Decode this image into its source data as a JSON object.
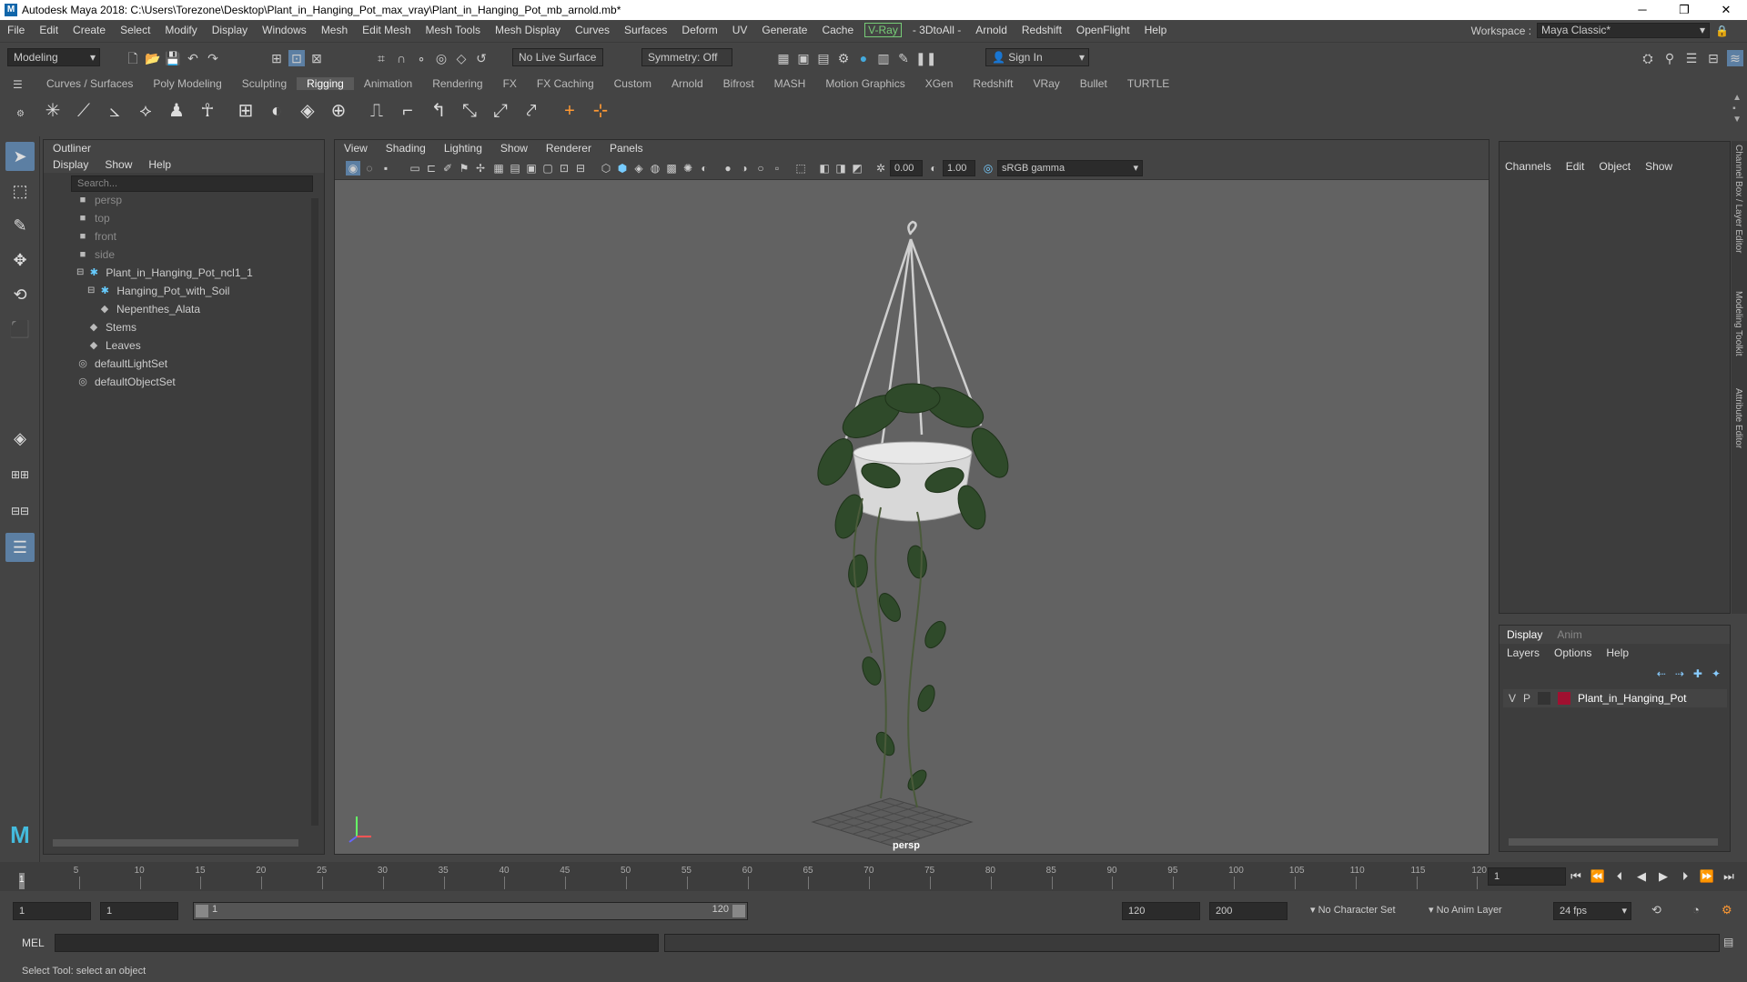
{
  "window": {
    "title": "Autodesk Maya 2018: C:\\Users\\Torezone\\Desktop\\Plant_in_Hanging_Pot_max_vray\\Plant_in_Hanging_Pot_mb_arnold.mb*",
    "logo": "M",
    "minimize": "─",
    "maximize": "❐",
    "close": "✕"
  },
  "menubar": {
    "items": [
      "File",
      "Edit",
      "Create",
      "Select",
      "Modify",
      "Display",
      "Windows",
      "Mesh",
      "Edit Mesh",
      "Mesh Tools",
      "Mesh Display",
      "Curves",
      "Surfaces",
      "Deform",
      "UV",
      "Generate",
      "Cache"
    ],
    "vray": "V-Ray",
    "items2": [
      "- 3DtoAll -",
      "Arnold",
      "Redshift",
      "OpenFlight",
      "Help"
    ]
  },
  "workspace": {
    "label": "Workspace :",
    "value": "Maya Classic*"
  },
  "statusline": {
    "mode": "Modeling",
    "live_surface": "No Live Surface",
    "symmetry": "Symmetry: Off",
    "sign_in": "Sign In"
  },
  "shelf": {
    "tabs": [
      "Curves / Surfaces",
      "Poly Modeling",
      "Sculpting",
      "Rigging",
      "Animation",
      "Rendering",
      "FX",
      "FX Caching",
      "Custom",
      "Arnold",
      "Bifrost",
      "MASH",
      "Motion Graphics",
      "XGen",
      "Redshift",
      "VRay",
      "Bullet",
      "TURTLE"
    ],
    "active_tab": "Rigging"
  },
  "outliner": {
    "title": "Outliner",
    "menu": [
      "Display",
      "Show",
      "Help"
    ],
    "search_placeholder": "Search...",
    "items": [
      {
        "label": "persp",
        "depth": 1,
        "icon": "camera-icon",
        "dim": true
      },
      {
        "label": "top",
        "depth": 1,
        "icon": "camera-icon",
        "dim": true
      },
      {
        "label": "front",
        "depth": 1,
        "icon": "camera-icon",
        "dim": true
      },
      {
        "label": "side",
        "depth": 1,
        "icon": "camera-icon",
        "dim": true
      },
      {
        "label": "Plant_in_Hanging_Pot_ncl1_1",
        "depth": 1,
        "icon": "joint-icon",
        "dim": false,
        "expander": "⊟"
      },
      {
        "label": "Hanging_Pot_with_Soil",
        "depth": 2,
        "icon": "joint-icon",
        "dim": false,
        "expander": "⊟"
      },
      {
        "label": "Nepenthes_Alata",
        "depth": 3,
        "icon": "mesh-icon",
        "dim": false
      },
      {
        "label": "Stems",
        "depth": 2,
        "icon": "mesh-icon",
        "dim": false
      },
      {
        "label": "Leaves",
        "depth": 2,
        "icon": "mesh-icon",
        "dim": false
      },
      {
        "label": "defaultLightSet",
        "depth": 1,
        "icon": "set-icon",
        "dim": false
      },
      {
        "label": "defaultObjectSet",
        "depth": 1,
        "icon": "set-icon",
        "dim": false
      }
    ]
  },
  "viewport": {
    "menu": [
      "View",
      "Shading",
      "Lighting",
      "Show",
      "Renderer",
      "Panels"
    ],
    "exposure": "0.00",
    "gamma": "1.00",
    "color_space": "sRGB gamma",
    "camera": "persp"
  },
  "channelbox": {
    "menu": [
      "Channels",
      "Edit",
      "Object",
      "Show"
    ]
  },
  "layers": {
    "tabs": [
      "Display",
      "Anim"
    ],
    "active_tab": "Display",
    "menu": [
      "Layers",
      "Options",
      "Help"
    ],
    "layer": {
      "v": "V",
      "p": "P",
      "name": "Plant_in_Hanging_Pot",
      "color": "#a01030"
    }
  },
  "sidetabs": [
    "Channel Box / Layer Editor",
    "Modeling Toolkit",
    "Attribute Editor"
  ],
  "timeline": {
    "ticks": [
      "5",
      "10",
      "15",
      "20",
      "25",
      "30",
      "35",
      "40",
      "45",
      "50",
      "55",
      "60",
      "65",
      "70",
      "75",
      "80",
      "85",
      "90",
      "95",
      "100",
      "105",
      "110",
      "115",
      "120"
    ],
    "current_frame": "1",
    "frame_field": "1"
  },
  "range": {
    "start": "1",
    "playback_start": "1",
    "slider_start": "1",
    "slider_end": "120",
    "playback_end": "120",
    "end": "200",
    "character_set": "No Character Set",
    "anim_layer": "No Anim Layer",
    "fps": "24 fps"
  },
  "cmdline": {
    "label": "MEL"
  },
  "helpline": {
    "text": "Select Tool: select an object"
  }
}
